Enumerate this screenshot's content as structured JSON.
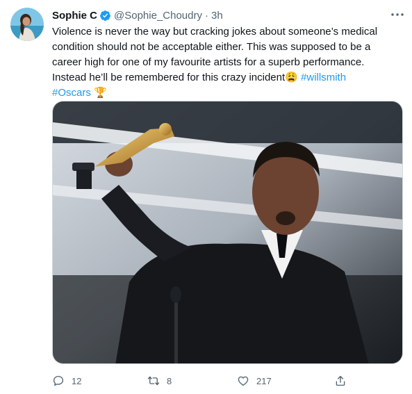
{
  "tweet": {
    "author_name": "Sophie C",
    "author_handle": "@Sophie_Choudry",
    "separator": "·",
    "time": "3h",
    "text_lines": [
      "Violence is never the way but cracking jokes about someone’s medical",
      "condition should not be acceptable either. This was supposed to be a",
      "career high for one of my favourite artists for a superb performance.",
      "Instead he’ll be remembered for this crazy incident"
    ],
    "emoji": "😩",
    "hashtag_1": "#willsmith",
    "hashtag_2": "#Oscars",
    "trophy_emoji": "🏆",
    "actions": {
      "reply_count": "12",
      "retweet_count": "8",
      "like_count": "217"
    }
  },
  "colors": {
    "link": "#1d9bf0",
    "verified": "#1d9bf0",
    "secondary_text": "#536471"
  },
  "icons": [
    "avatar",
    "verified-badge-icon",
    "more-icon",
    "reply-icon",
    "retweet-icon",
    "like-icon",
    "share-icon"
  ]
}
